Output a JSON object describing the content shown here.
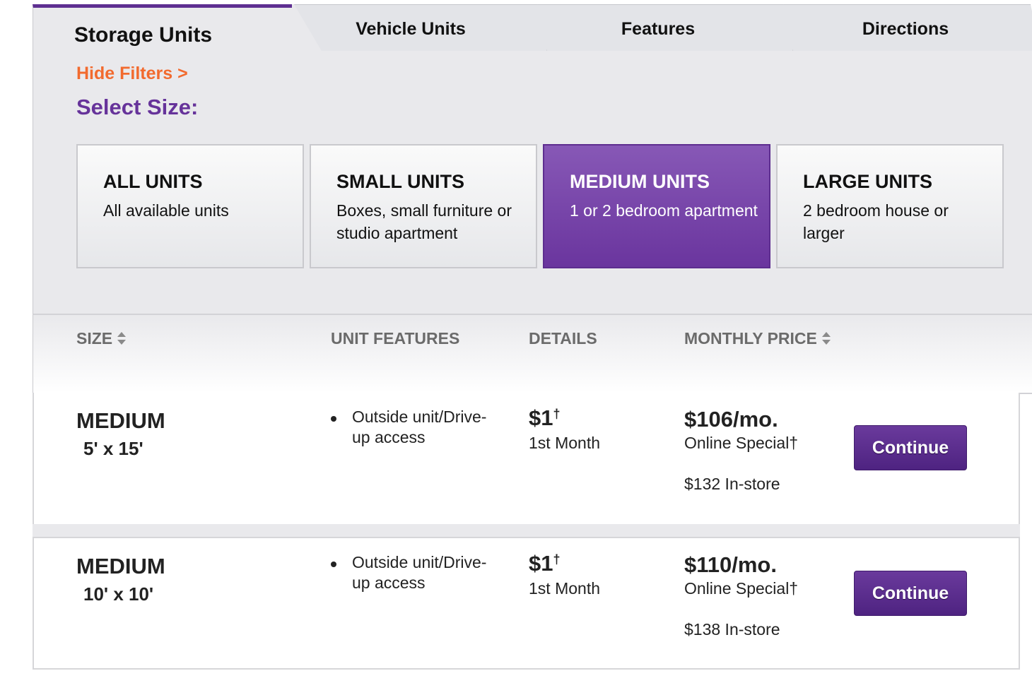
{
  "tabs": [
    {
      "label": "Storage Units",
      "active": true
    },
    {
      "label": "Vehicle Units",
      "active": false
    },
    {
      "label": "Features",
      "active": false
    },
    {
      "label": "Directions",
      "active": false
    }
  ],
  "filters": {
    "hide_label": "Hide Filters >",
    "select_size_label": "Select Size:",
    "sizes": [
      {
        "title": "ALL UNITS",
        "desc": "All available units",
        "selected": false
      },
      {
        "title": "SMALL UNITS",
        "desc": "Boxes, small furniture or studio apartment",
        "selected": false
      },
      {
        "title": "MEDIUM UNITS",
        "desc": "1 or 2 bedroom apartment",
        "selected": true
      },
      {
        "title": "LARGE UNITS",
        "desc": "2 bedroom house or larger",
        "selected": false
      }
    ]
  },
  "table": {
    "columns": {
      "size": "SIZE",
      "features": "UNIT FEATURES",
      "details": "DETAILS",
      "price": "MONTHLY PRICE"
    },
    "rows": [
      {
        "size": "MEDIUM",
        "dims": "5' x 15'",
        "feature": "Outside unit/Drive-up access",
        "deal": "$1",
        "dagger": "†",
        "deal_sub": "1st Month",
        "price": "$106/mo.",
        "price_sub": "Online Special†",
        "instore": "$132 In-store",
        "button": "Continue"
      },
      {
        "size": "MEDIUM",
        "dims": "10' x 10'",
        "feature": "Outside unit/Drive-up access",
        "deal": "$1",
        "dagger": "†",
        "deal_sub": "1st Month",
        "price": "$110/mo.",
        "price_sub": "Online Special†",
        "instore": "$138 In-store",
        "button": "Continue"
      }
    ]
  },
  "colors": {
    "brand_purple": "#66339a",
    "accent_orange": "#f26a2e",
    "button_purple": "#5a2b8c"
  }
}
